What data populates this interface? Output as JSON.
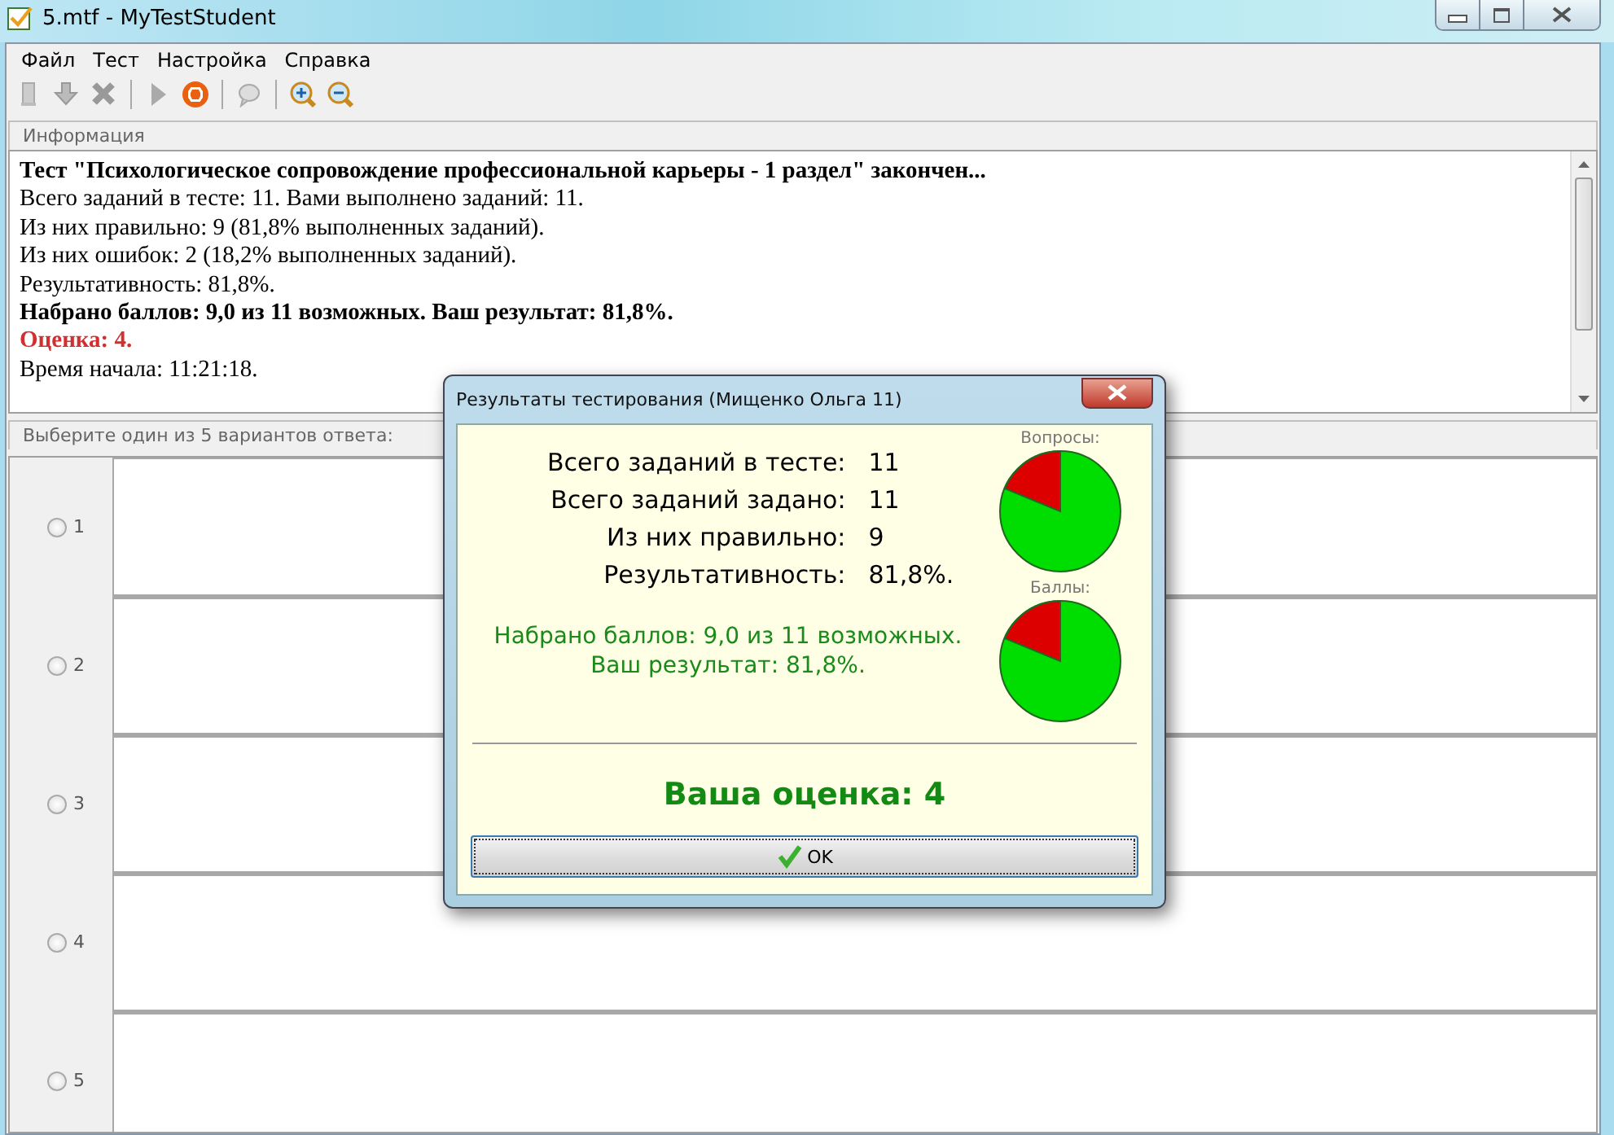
{
  "window": {
    "title": "5.mtf - MyTestStudent"
  },
  "menu": [
    "Файл",
    "Тест",
    "Настройка",
    "Справка"
  ],
  "info_panel": {
    "header": "Информация",
    "lines": [
      {
        "text": "Тест \"Психологическое сопровождение профессиональной карьеры - 1 раздел\" закончен...",
        "kind": "bold"
      },
      {
        "text": "Всего заданий в тесте: 11. Вами выполнено заданий: 11.",
        "kind": "plain"
      },
      {
        "text": "Из них правильно: 9 (81,8% выполненных заданий).",
        "kind": "plain"
      },
      {
        "text": "Из них ошибок: 2 (18,2% выполненных заданий).",
        "kind": "plain"
      },
      {
        "text": "Результативность: 81,8%.",
        "kind": "plain"
      },
      {
        "text": "Набрано баллов: 9,0 из 11 возможных. Ваш результат: 81,8%.",
        "kind": "bold"
      },
      {
        "text": "Оценка: 4.",
        "kind": "grade"
      },
      {
        "text": "Время начала: 11:21:18.",
        "kind": "plain"
      }
    ]
  },
  "answers": {
    "header": "Выберите один из 5 вариантов ответа:",
    "options": [
      {
        "label": "1",
        "selected": false
      },
      {
        "label": "2",
        "selected": false
      },
      {
        "label": "3",
        "selected": false
      },
      {
        "label": "4",
        "selected": false
      },
      {
        "label": "5",
        "selected": false
      }
    ]
  },
  "dialog": {
    "title": "Результаты тестирования (Мищенко Ольга 11)",
    "stats": [
      {
        "label": "Всего заданий в тесте:",
        "value": "11"
      },
      {
        "label": "Всего заданий задано:",
        "value": "11"
      },
      {
        "label": "Из них правильно:",
        "value": "9"
      },
      {
        "label": "Результативность:",
        "value": "81,8%."
      }
    ],
    "score_lines": [
      "Набрано баллов: 9,0 из 11 возможных.",
      "Ваш результат: 81,8%."
    ],
    "pie_labels": [
      "Вопросы:",
      "Баллы:"
    ],
    "grade": "Ваша оценка: 4",
    "ok_button": "OK"
  }
}
